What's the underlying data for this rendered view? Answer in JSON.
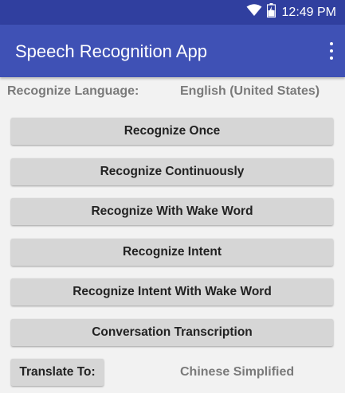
{
  "status_bar": {
    "time": "12:49 PM",
    "icons": [
      "wifi-icon",
      "battery-icon"
    ]
  },
  "app_bar": {
    "title": "Speech Recognition App",
    "menu_icon": "overflow-menu-icon"
  },
  "language": {
    "label": "Recognize Language:",
    "value": "English (United States)"
  },
  "buttons": [
    {
      "label": "Recognize Once"
    },
    {
      "label": "Recognize Continuously"
    },
    {
      "label": "Recognize With Wake Word"
    },
    {
      "label": "Recognize Intent"
    },
    {
      "label": "Recognize Intent With Wake Word"
    },
    {
      "label": "Conversation Transcription"
    }
  ],
  "translate": {
    "button_label": "Translate To:",
    "value": "Chinese Simplified"
  },
  "colors": {
    "status_bar": "#303f9f",
    "app_bar": "#3f51b5",
    "background": "#f2f2f2",
    "button": "#d6d6d6",
    "secondary_text": "#7a7a7a"
  }
}
